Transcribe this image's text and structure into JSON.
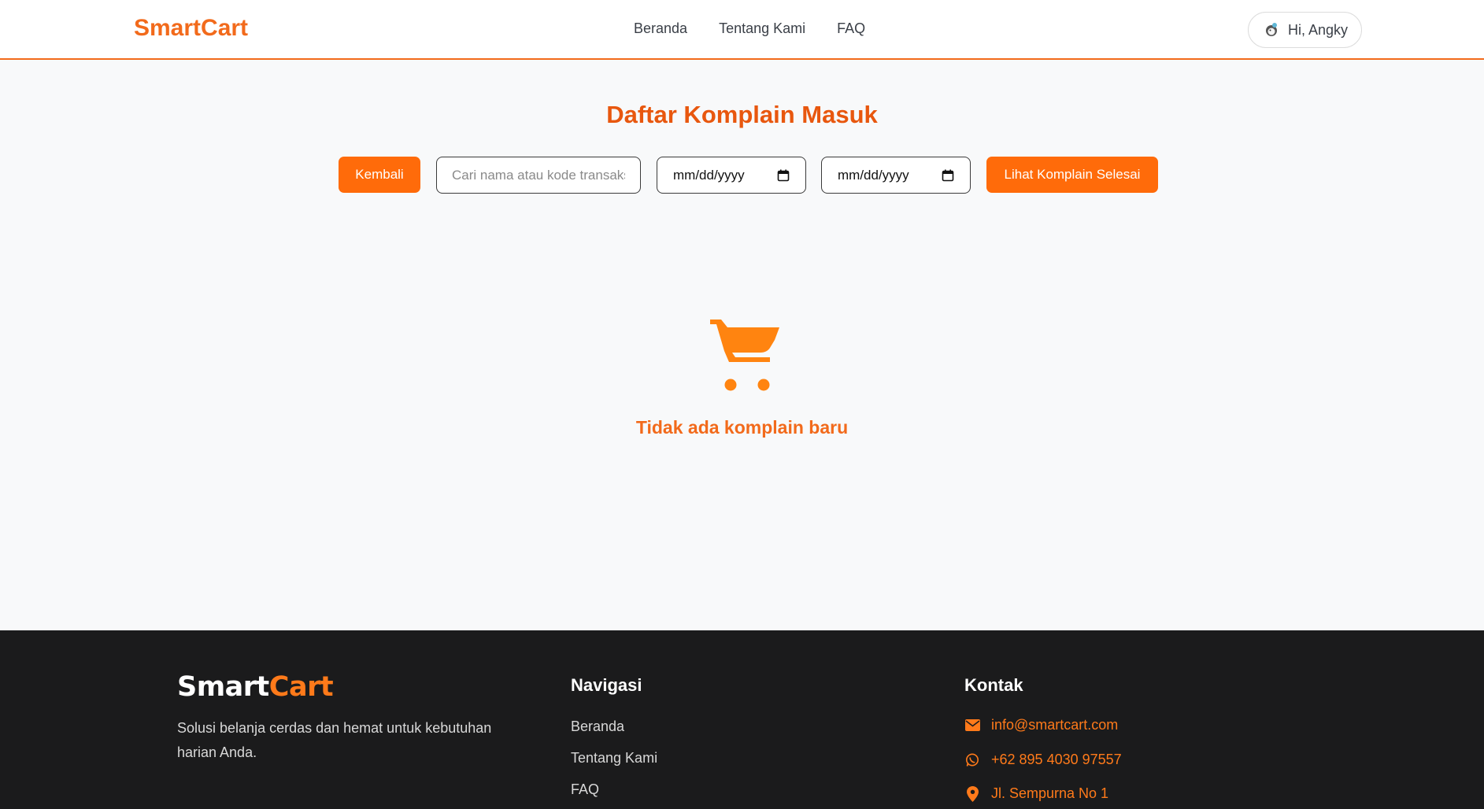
{
  "header": {
    "brand": "SmartCart",
    "nav": [
      "Beranda",
      "Tentang Kami",
      "FAQ"
    ],
    "user_greeting": "Hi, Angky"
  },
  "main": {
    "title": "Daftar Komplain Masuk",
    "back_label": "Kembali",
    "search_placeholder": "Cari nama atau kode transaksi",
    "date_from_placeholder": "mm/dd/yyyy",
    "date_to_placeholder": "mm/dd/yyyy",
    "completed_label": "Lihat Komplain Selesai",
    "empty_message": "Tidak ada komplain baru"
  },
  "footer": {
    "brand_white": "Smart",
    "brand_orange": "Cart",
    "description": "Solusi belanja cerdas dan hemat untuk kebutuhan harian Anda.",
    "nav_heading": "Navigasi",
    "nav_links": [
      "Beranda",
      "Tentang Kami",
      "FAQ"
    ],
    "contact_heading": "Kontak",
    "email": "info@smartcart.com",
    "phone": "+62 895 4030 97557",
    "address": "Jl. Sempurna No 1"
  },
  "colors": {
    "accent": "#ff6b0a",
    "title": "#e8570e",
    "footer_bg": "#1b1b1c"
  },
  "icons": {
    "empty_state": "shopping-cart-icon",
    "email": "envelope-icon",
    "phone": "whatsapp-icon",
    "address": "map-pin-icon",
    "date": "calendar-icon"
  }
}
